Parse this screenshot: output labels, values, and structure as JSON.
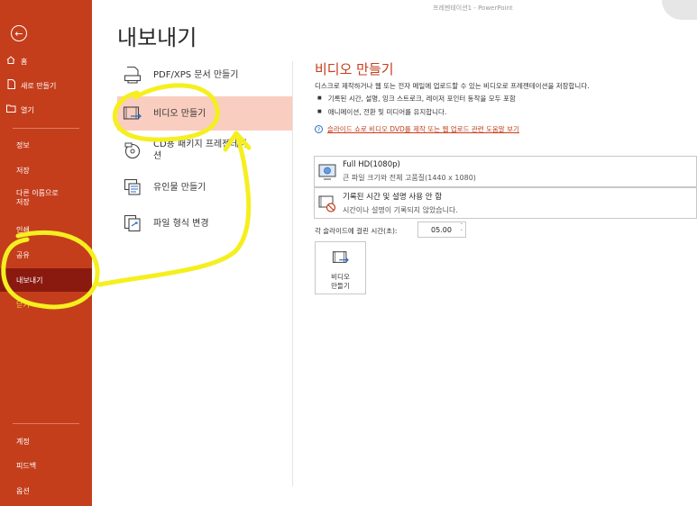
{
  "window": {
    "title": "프레젠테이션1  -  PowerPoint"
  },
  "sidebar": {
    "back_label": "←",
    "items": [
      {
        "label": "홈",
        "icon": "home-icon"
      },
      {
        "label": "새로 만들기",
        "icon": "new-document-icon"
      },
      {
        "label": "열기",
        "icon": "open-folder-icon"
      },
      {
        "label": "정보"
      },
      {
        "label": "저장"
      },
      {
        "label": "다른 이름으로\n저장"
      },
      {
        "label": "인쇄"
      },
      {
        "label": "공유"
      },
      {
        "label": "내보내기"
      },
      {
        "label": "닫기"
      },
      {
        "label": "계정"
      },
      {
        "label": "피드백"
      },
      {
        "label": "옵션"
      }
    ]
  },
  "page": {
    "title": "내보내기"
  },
  "export_options": [
    {
      "label": "PDF/XPS 문서 만들기",
      "icon": "pdf-xps-icon"
    },
    {
      "label": "비디오 만들기",
      "icon": "video-icon"
    },
    {
      "label": "CD용 패키지 프레젠테이\n션",
      "icon": "cd-package-icon"
    },
    {
      "label": "유인물 만들기",
      "icon": "handout-icon"
    },
    {
      "label": "파일 형식 변경",
      "icon": "file-type-icon"
    }
  ],
  "detail": {
    "title": "비디오 만들기",
    "description": "디스크로 제작하거나 웹 또는 전자 메일에 업로드할 수 있는 비디오로 프레젠테이션을 저장합니다.",
    "bullets": [
      "기록된 시간, 설명, 잉크 스트로크, 레이저 포인터 동작을 모두 포함",
      "애니메이션, 전환 및 미디어를 유지합니다."
    ],
    "bullet_symbol": "■",
    "help_link": "슬라이드 쇼로 비디오 DVD를 제작 또는 웹 업로드 관련 도움말 보기",
    "quality_dropdown": {
      "title": "Full HD(1080p)",
      "subtitle": "큰 파일 크기와 전체 고품질(1440 x 1080)"
    },
    "timing_dropdown": {
      "title": "기록된 시간 및 설명 사용 안 함",
      "subtitle": "시간이나 설명이 기록되지 않았습니다."
    },
    "seconds_label": "각 슬라이드에 걸린 시간(초):",
    "seconds_value": "05.00",
    "create_button_label": "비디오\n만들기"
  },
  "colors": {
    "sidebar_bg": "#c43e1c",
    "sidebar_active": "#8a1a10",
    "selected_option": "#f9cdbf",
    "accent": "#c43e1c",
    "annotation": "#f5ef1f"
  }
}
